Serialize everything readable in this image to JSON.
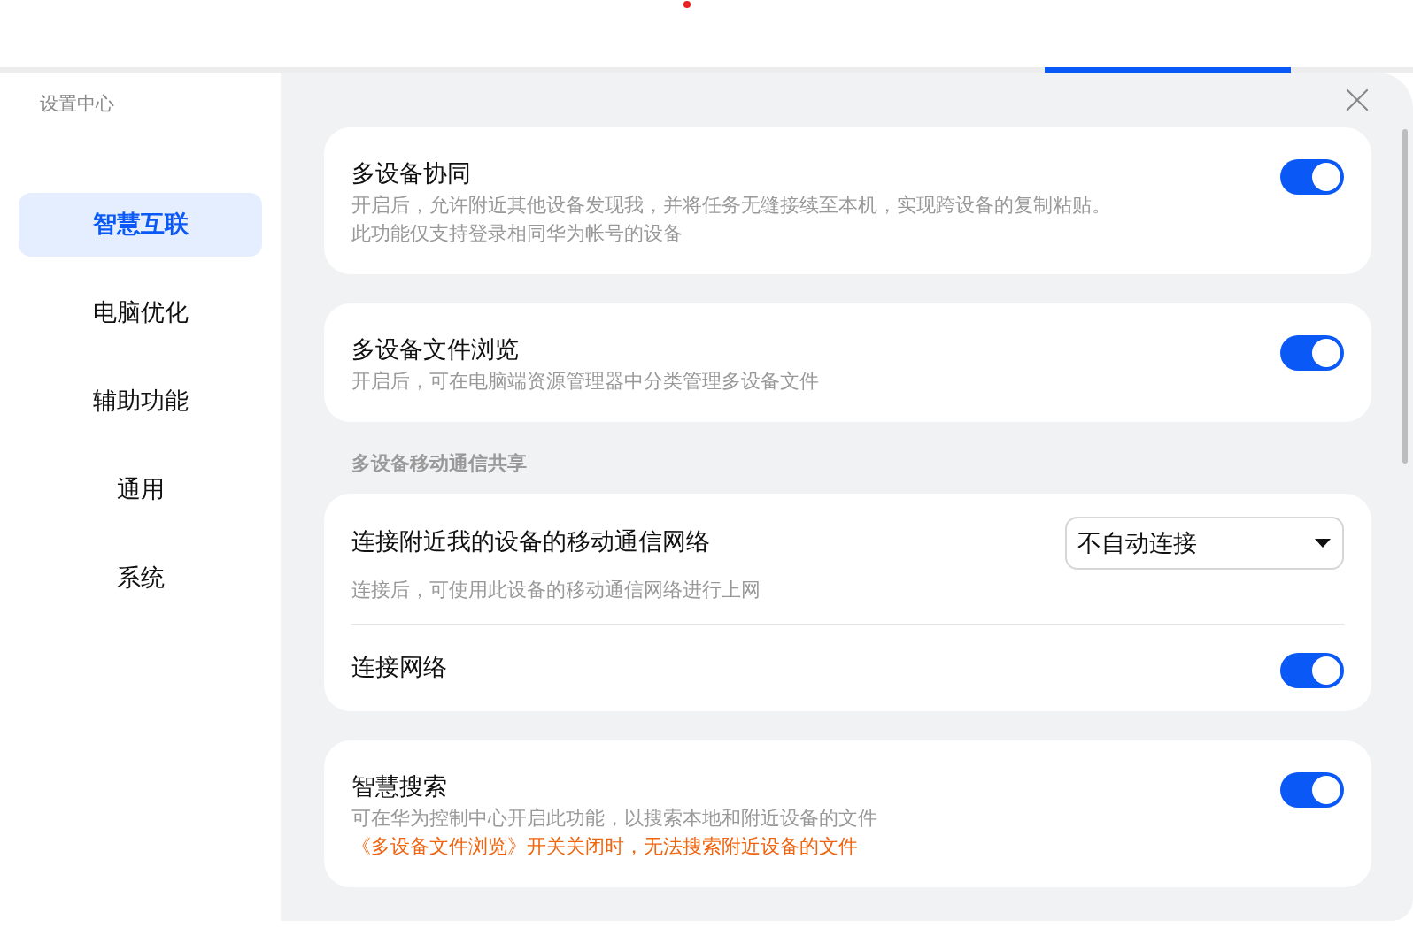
{
  "window": {
    "title": "设置中心"
  },
  "sidebar": {
    "items": [
      {
        "label": "智慧互联",
        "selected": true
      },
      {
        "label": "电脑优化",
        "selected": false
      },
      {
        "label": "辅助功能",
        "selected": false
      },
      {
        "label": "通用",
        "selected": false
      },
      {
        "label": "系统",
        "selected": false
      }
    ]
  },
  "sections": [
    {
      "cards": [
        {
          "rows": [
            {
              "kind": "toggle",
              "title": "多设备协同",
              "on": true,
              "lines": [
                "开启后，允许附近其他设备发现我，并将任务无缝接续至本机，实现跨设备的复制粘贴。",
                "此功能仅支持登录相同华为帐号的设备"
              ]
            }
          ]
        },
        {
          "rows": [
            {
              "kind": "toggle",
              "title": "多设备文件浏览",
              "on": true,
              "lines": [
                "开启后，可在电脑端资源管理器中分类管理多设备文件"
              ]
            }
          ]
        }
      ]
    },
    {
      "header": "多设备移动通信共享",
      "cards": [
        {
          "rows": [
            {
              "kind": "select",
              "title": "连接附近我的设备的移动通信网络",
              "value": "不自动连接",
              "lines": [
                "连接后，可使用此设备的移动通信网络进行上网"
              ]
            },
            {
              "kind": "toggle",
              "title": "连接网络",
              "on": true,
              "lines": []
            }
          ]
        },
        {
          "rows": [
            {
              "kind": "toggle",
              "title": "智慧搜索",
              "on": true,
              "lines": [
                "可在华为控制中心开启此功能，以搜索本地和附近设备的文件"
              ],
              "warning": "《多设备文件浏览》开关关闭时，无法搜索附近设备的文件"
            }
          ]
        }
      ]
    }
  ]
}
